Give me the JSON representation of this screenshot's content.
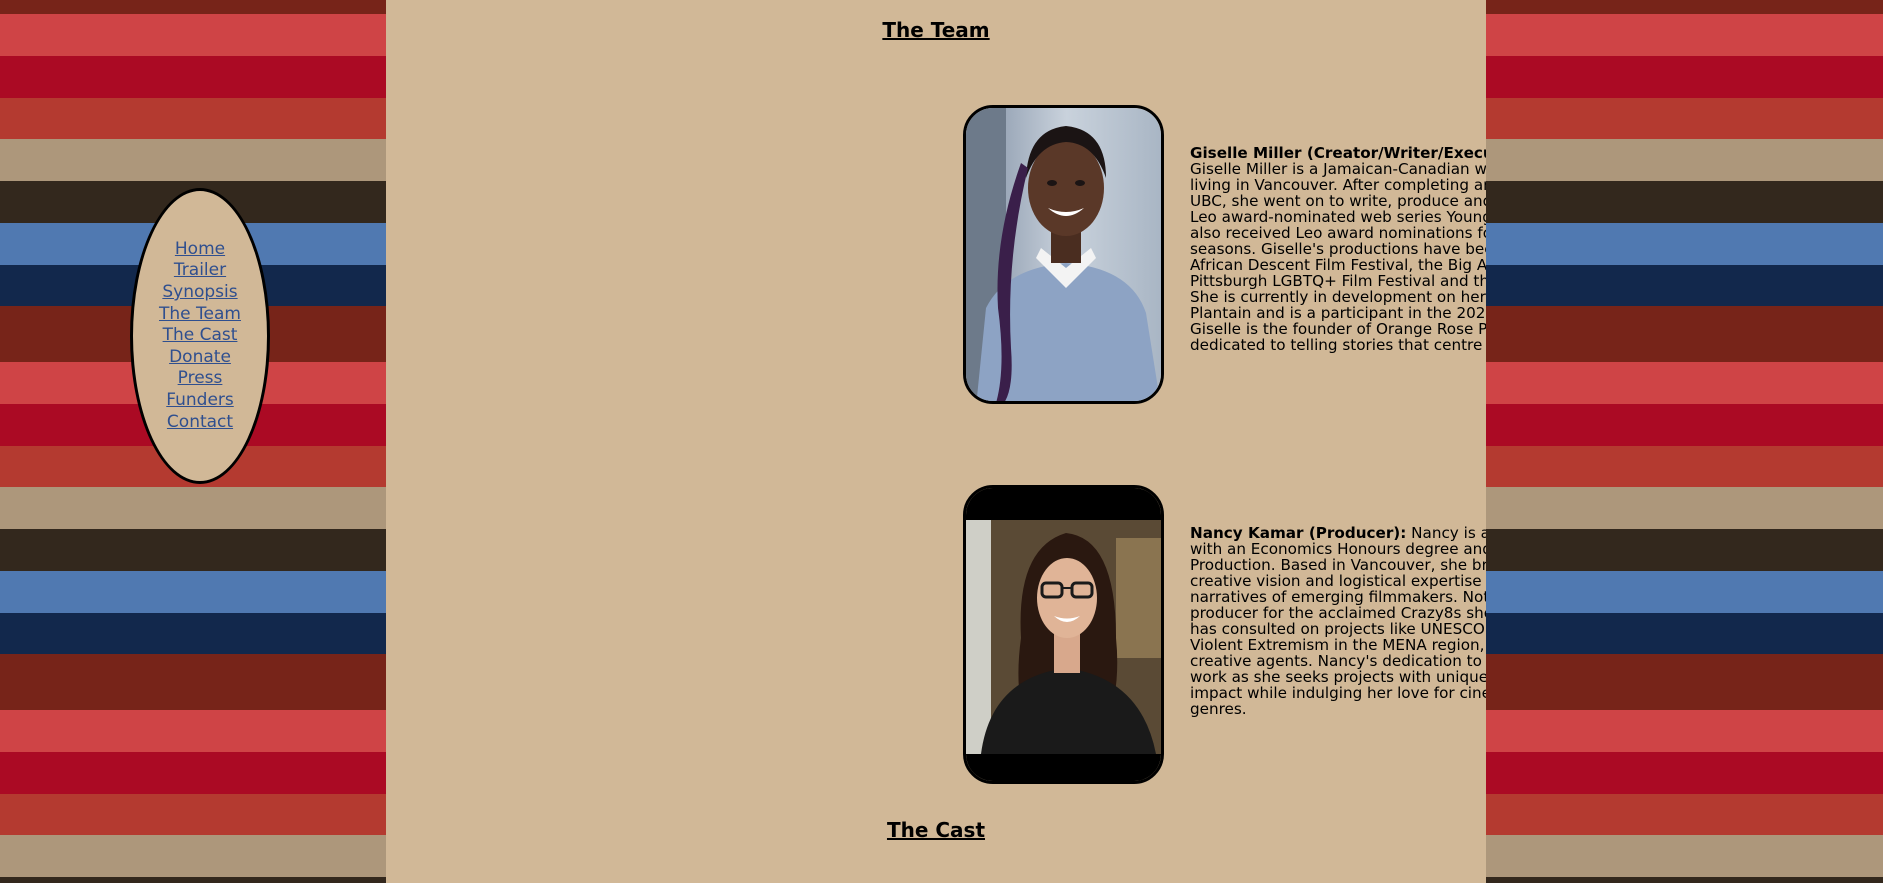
{
  "nav": {
    "items": [
      "Home",
      "Trailer",
      "Synopsis",
      "The Team",
      "The Cast",
      "Donate",
      "Press",
      "Funders",
      "Contact"
    ]
  },
  "team_heading": "The Team",
  "cast_heading": "The Cast",
  "members": [
    {
      "name": "Giselle Miller (Creator/Writer/Executive Producer/Director):",
      "bio": "Giselle Miller is a Jamaican-Canadian writer, actor and filmmaker living in Vancouver. After completing an MFA in Creative Writing at UBC, she went on to write, produce and direct two seasons of the Leo award-nominated web series Young, Single and Black. Giselle also received Leo award nominations for her performance in both seasons. Giselle's productions have been featured in the Women of African Descent Film Festival, the Big Apple Film Festival, the Reel Q: Pittsburgh LGBTQ+ Film Festival and the Roma Shorts Film Festival. She is currently in development on her first feature film Sweet Plantain and is a participant in the 2023 Whistler Screenwriters Lab. Giselle is the founder of Orange Rose Productions, a company dedicated to telling stories that centre black people."
    },
    {
      "name": "Nancy Kamar (Producer):",
      "bio": "Nancy is a Lebanese-Canadian producer with an Economics Honours degree and a background in Film Production. Based in Vancouver, she brings a unique blend of creative vision and logistical expertise to filmmaking, elevating the narratives of emerging filmmakers. Notably, she served as lead producer for the acclaimed Crazy8s short film \"High End Dying\" and has consulted on projects like UNESCO's initiative on Preventing Violent Extremism in the MENA region, empowering women as creative agents. Nancy's dedication to storytelling is evident in her work as she seeks projects with unique perspectives and societal impact while indulging her love for cinema as an avid viewer across genres."
    }
  ]
}
